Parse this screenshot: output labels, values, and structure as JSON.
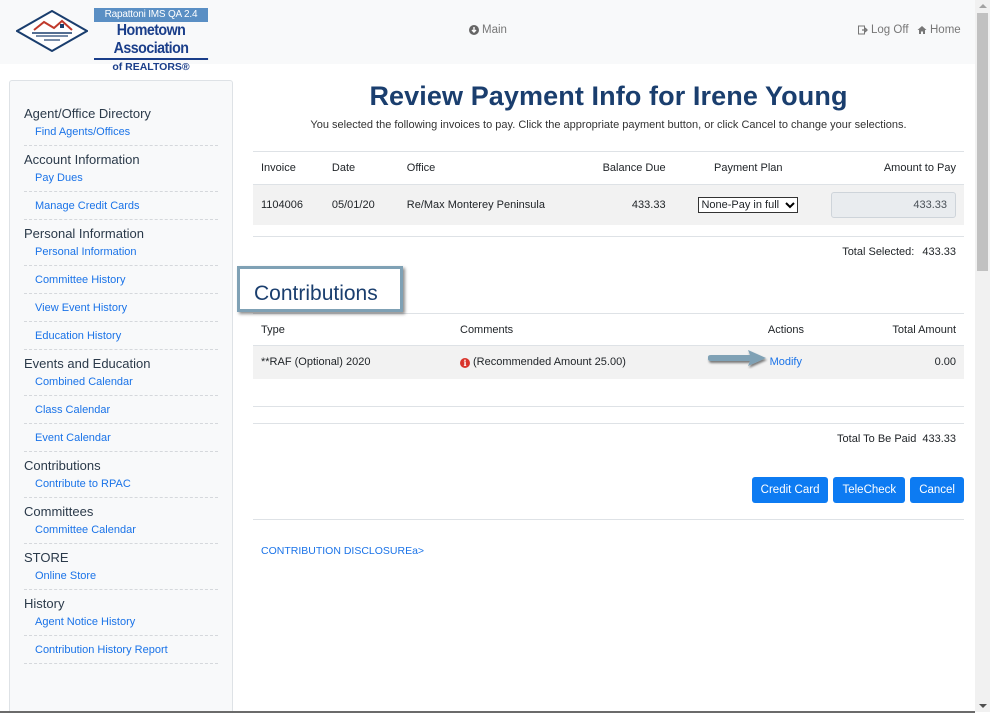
{
  "header": {
    "logo": {
      "badge": "Rapattoni IMS QA 2.4",
      "main": "Hometown Association",
      "sub": "of REALTORS®",
      "diamond_text": "HOMETOWN ASSOCIATION REALTORS"
    },
    "nav": {
      "main_label": "Main",
      "logoff_label": "Log Off",
      "home_label": "Home"
    }
  },
  "sidebar": {
    "groups": [
      {
        "title": "Agent/Office Directory",
        "items": [
          "Find Agents/Offices"
        ]
      },
      {
        "title": "Account Information",
        "items": [
          "Pay Dues",
          "Manage Credit Cards"
        ]
      },
      {
        "title": "Personal Information",
        "items": [
          "Personal Information",
          "Committee History",
          "View Event History",
          "Education History"
        ]
      },
      {
        "title": "Events and Education",
        "items": [
          "Combined Calendar",
          "Class Calendar",
          "Event Calendar"
        ]
      },
      {
        "title": "Contributions",
        "items": [
          "Contribute to RPAC"
        ]
      },
      {
        "title": "Committees",
        "items": [
          "Committee Calendar"
        ]
      },
      {
        "title": "STORE",
        "items": [
          "Online Store"
        ]
      },
      {
        "title": "History",
        "items": [
          "Agent Notice History",
          "Contribution History Report"
        ]
      }
    ]
  },
  "main": {
    "title": "Review Payment Info for Irene Young",
    "subtitle": "You selected the following invoices to pay. Click the appropriate payment button, or click Cancel to change your selections.",
    "invoices": {
      "headers": [
        "Invoice",
        "Date",
        "Office",
        "Balance Due",
        "Payment Plan",
        "Amount to Pay"
      ],
      "rows": [
        {
          "invoice": "1104006",
          "date": "05/01/20",
          "office": "Re/Max Monterey Peninsula",
          "balance_due": "433.33",
          "payment_plan": "None-Pay in full",
          "amount_to_pay": "433.33"
        }
      ],
      "total_label": "Total Selected:",
      "total_value": "433.33"
    },
    "contributions": {
      "title": "Contributions",
      "headers": [
        "Type",
        "Comments",
        "Actions",
        "Total Amount"
      ],
      "rows": [
        {
          "type": "**RAF (Optional) 2020",
          "comment": "(Recommended Amount 25.00)",
          "action": "Modify",
          "total": "0.00"
        }
      ]
    },
    "total_paid_label": "Total To Be Paid",
    "total_paid_value": "433.33",
    "buttons": {
      "credit_card": "Credit Card",
      "telecheck": "TeleCheck",
      "cancel": "Cancel"
    },
    "disclosure_link": "CONTRIBUTION DISCLOSUREa>"
  },
  "colors": {
    "primary_button": "#0d7bf2",
    "link": "#1a73e8",
    "title": "#1a3e6e",
    "info_icon": "#d9342b",
    "annotation_border": "#7fa1b5"
  }
}
